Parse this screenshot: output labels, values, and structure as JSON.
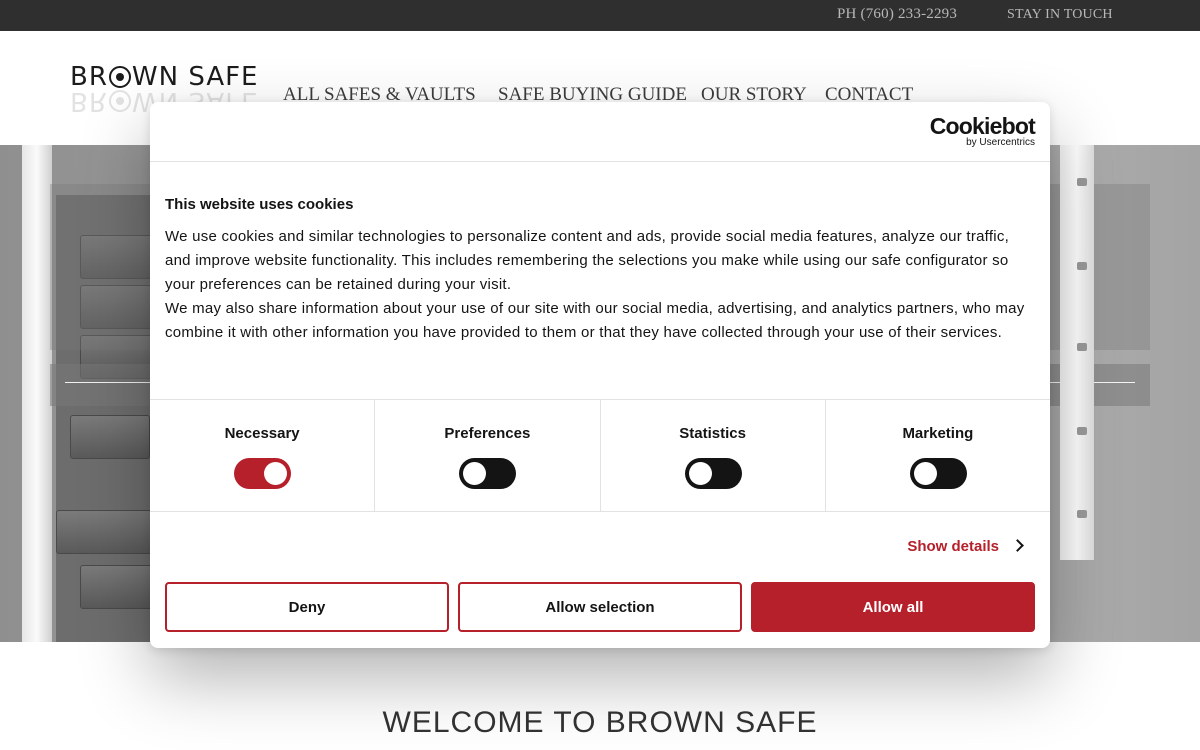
{
  "topbar": {
    "phone": "PH (760) 233-2293",
    "stay_in_touch": "STAY IN TOUCH"
  },
  "header": {
    "logo_text_1": "BR",
    "logo_text_2": "WN SAFE",
    "nav": [
      {
        "label": "ALL SAFES & VAULTS"
      },
      {
        "label": "SAFE BUYING GUIDE"
      },
      {
        "label": "OUR STORY"
      },
      {
        "label": "CONTACT"
      }
    ]
  },
  "welcome": "WELCOME TO BROWN SAFE",
  "cookie_dialog": {
    "brand_name": "Cookiebot",
    "brand_sub": "by Usercentrics",
    "title": "This website uses cookies",
    "body": [
      "We use cookies and similar technologies to personalize content and ads, provide social media features, analyze our traffic, and improve website functionality. This includes remembering the selections you make while using our safe configurator so your preferences can be retained during your visit.",
      "We may also share information about your use of our site with our social media, advertising, and analytics partners, who may combine it with other information you have provided to them or that they have collected through your use of their services."
    ],
    "categories": [
      {
        "label": "Necessary",
        "enabled": true
      },
      {
        "label": "Preferences",
        "enabled": false
      },
      {
        "label": "Statistics",
        "enabled": false
      },
      {
        "label": "Marketing",
        "enabled": false
      }
    ],
    "show_details": "Show details",
    "buttons": {
      "deny": "Deny",
      "allow_selection": "Allow selection",
      "allow_all": "Allow all"
    }
  },
  "colors": {
    "accent": "#b5202a",
    "topbar": "#2f2f2f",
    "toggle_off": "#141414"
  }
}
